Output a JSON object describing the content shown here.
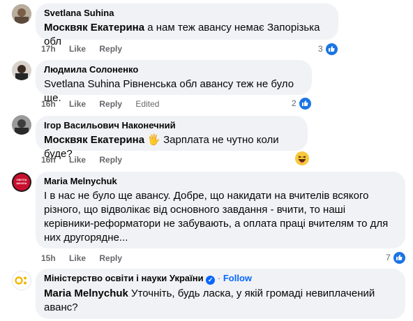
{
  "comments": [
    {
      "author": "Svetlana Suhina",
      "mention": "Москвяк Екатерина",
      "text": " а нам теж авансу немає Запорізька обл",
      "time": "17h",
      "like": "Like",
      "reply": "Reply",
      "reactions": "3"
    },
    {
      "author": "Людмила Солоненко",
      "mention": "",
      "text": "Svetlana Suhina Рівненська обл авансу теж не було ще.",
      "time": "16h",
      "like": "Like",
      "reply": "Reply",
      "edited": "Edited",
      "reactions": "2"
    },
    {
      "author": "Ігор Васильович Наконечний",
      "mention": "Москвяк Екатерина",
      "emoji": "🖐",
      "text": " Зарплата не чутно коли буде?",
      "time": "16h",
      "like": "Like",
      "reply": "Reply"
    },
    {
      "author": "Maria Melnychuk",
      "text": "І в нас не було ще авансу. Добре, що накидати на вчителів всякого різного, що відволікає від основного завдання - вчити, то наші керівники-реформатори не забувають, а оплата праці вчителям то для них другорядне...",
      "time": "15h",
      "like": "Like",
      "reply": "Reply",
      "reactions": "7",
      "avatar_text": "СВІТЛА ШКОЛА"
    },
    {
      "author": "Міністерство освіти і науки України",
      "follow": "Follow",
      "separator": "·",
      "mention": "Maria Melnychuk",
      "text": " Уточніть, будь ласка, у якій громаді невиплачений аванс?"
    }
  ],
  "colors": {
    "bubble": "#f0f2f5",
    "meta": "#65676b",
    "like_blue": "#1b74e4",
    "follow_blue": "#0866ff"
  }
}
